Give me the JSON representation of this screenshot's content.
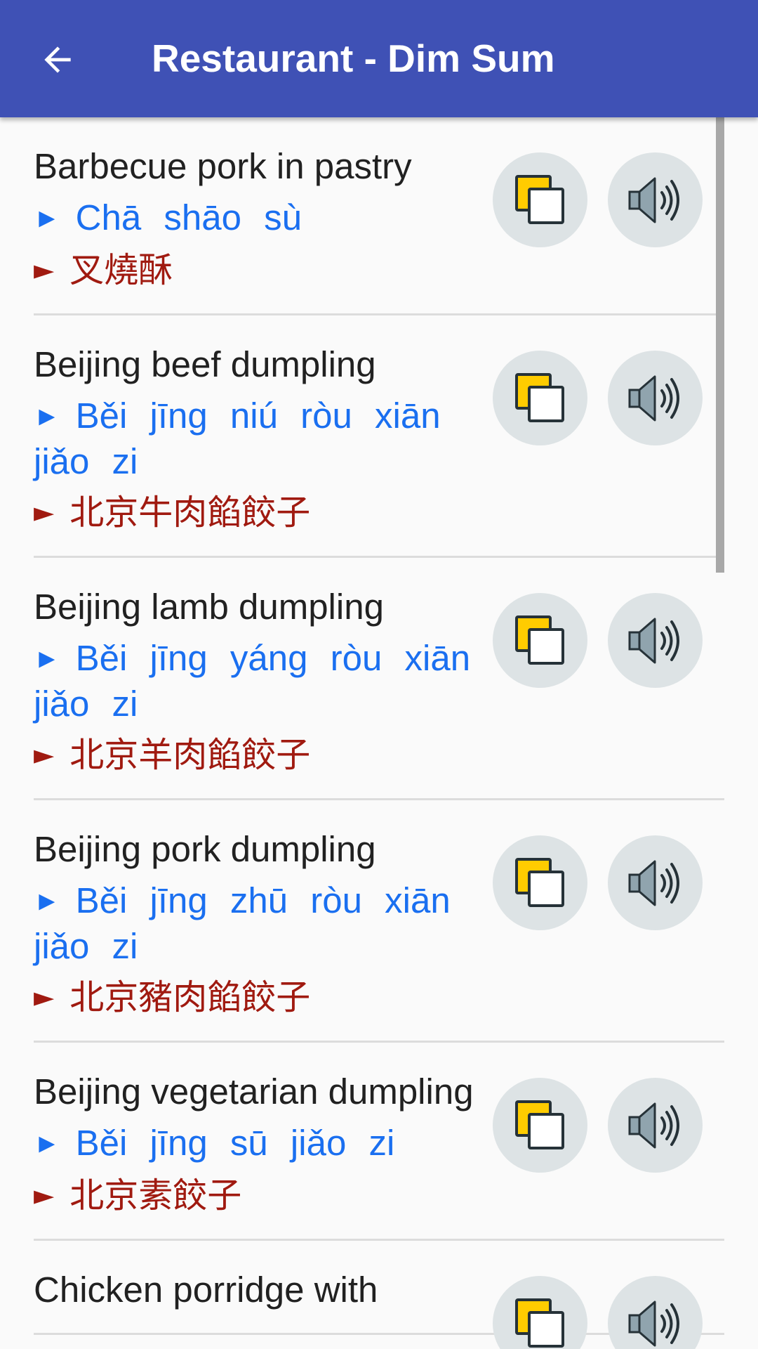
{
  "app_bar": {
    "title": "Restaurant - Dim Sum",
    "back_icon": "arrow-back-icon"
  },
  "items": [
    {
      "english": "Barbecue pork in pastry",
      "pinyin": "Chā shāo sù",
      "chinese": "叉燒酥"
    },
    {
      "english": "Beijing beef dumpling",
      "pinyin": "Běi jīng niú ròu xiān jiǎo zi",
      "chinese": "北京牛肉餡餃子"
    },
    {
      "english": "Beijing lamb dumpling",
      "pinyin": "Běi jīng yáng ròu xiān jiǎo zi",
      "chinese": "北京羊肉餡餃子"
    },
    {
      "english": "Beijing pork dumpling",
      "pinyin": "Běi jīng zhū ròu xiān jiǎo zi",
      "chinese": "北京豬肉餡餃子"
    },
    {
      "english": "Beijing vegetarian dumpling",
      "pinyin": "Běi jīng sū jiǎo zi",
      "chinese": "北京素餃子"
    },
    {
      "english": "Chicken porridge with",
      "pinyin": "",
      "chinese": ""
    }
  ],
  "marker": "►",
  "icons": {
    "copy": "copy-icon",
    "speaker": "speaker-icon"
  },
  "colors": {
    "app_bar": "#3f51b5",
    "pinyin": "#1a6ff0",
    "chinese": "#a01a10",
    "copy_icon_fill": "#ffcc00",
    "button_bg": "#dde3e5"
  }
}
